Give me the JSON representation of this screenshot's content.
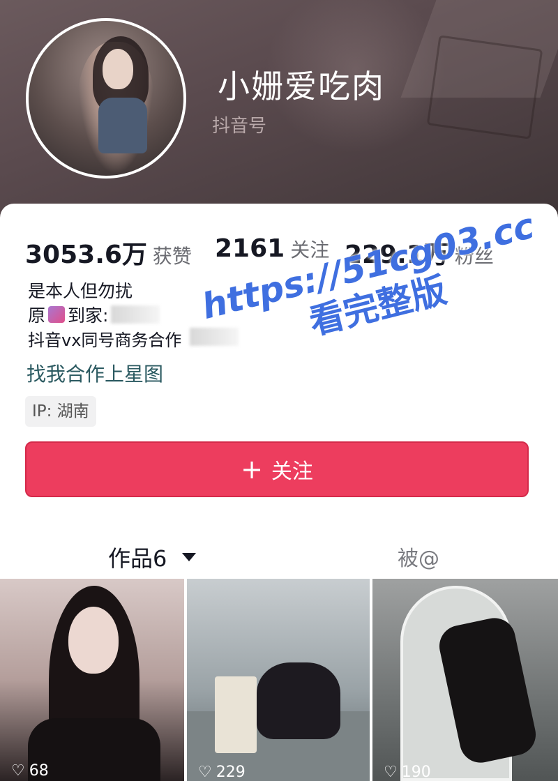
{
  "profile": {
    "nickname": "小姗爱吃肉",
    "account_id_label": "抖音号"
  },
  "stats": {
    "likes": {
      "value": "3053.6万",
      "label": "获赞"
    },
    "following": {
      "value": "2161",
      "label": "关注"
    },
    "followers": {
      "value": "229.1万",
      "label": "粉丝"
    }
  },
  "bio": {
    "line1": "是本人但勿扰",
    "line2_prefix": "原",
    "line2_suffix": "到家:",
    "line3": "抖音vx同号商务合作"
  },
  "starmap_link": "找我合作上星图",
  "ip_location": "IP: 湖南",
  "follow_button": {
    "icon": "+",
    "label": "关注"
  },
  "tabs": {
    "works": "作品6",
    "mentions": "被@"
  },
  "videos": [
    {
      "likes": "68"
    },
    {
      "likes": "229"
    },
    {
      "likes": "190"
    }
  ],
  "watermark": {
    "url": "https://51cg03.cc",
    "text": "看完整版"
  },
  "colors": {
    "accent": "#ed3d5e",
    "watermark": "#3f6fe0",
    "link": "#2b5a61"
  }
}
